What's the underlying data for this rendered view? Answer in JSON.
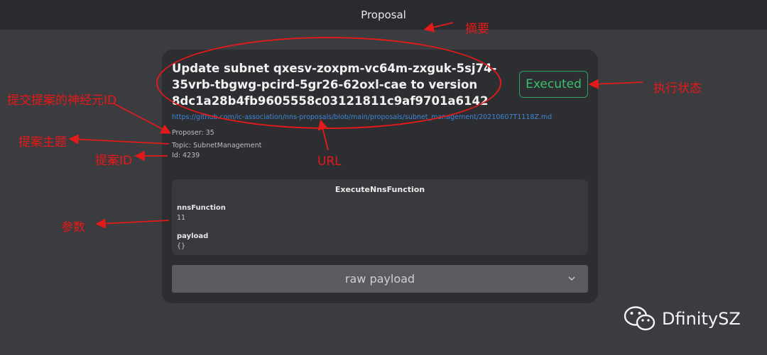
{
  "header": {
    "title": "Proposal"
  },
  "proposal": {
    "title": "Update subnet qxesv-zoxpm-vc64m-zxguk-5sj74-35vrb-tbgwg-pcird-5gr26-62oxl-cae to version 8dc1a28b4fb9605558c03121811c9af9701a6142",
    "status": "Executed",
    "url": "https://github.com/ic-association/nns-proposals/blob/main/proposals/subnet_management/20210607T1118Z.md",
    "proposer": "Proposer: 35",
    "topic": "Topic: SubnetManagement",
    "id": "Id: 4239",
    "payload": {
      "header": "ExecuteNnsFunction",
      "fields": [
        {
          "label": "nnsFunction",
          "value": "11"
        },
        {
          "label": "payload",
          "value": "{}"
        }
      ]
    },
    "raw_payload_label": "raw payload"
  },
  "annotations": {
    "summary": "摘要",
    "status": "执行状态",
    "proposer": "提交提案的神经元ID",
    "topic": "提案主题",
    "id": "提案ID",
    "url": "URL",
    "params": "参数"
  },
  "watermark": {
    "text": "DfinitySZ",
    "icon": "wechat-icon"
  },
  "colors": {
    "background": "#3a3c40",
    "card": "#2d2e31",
    "status_green": "#3cc06d",
    "link_blue": "#3f86d6",
    "annotation_red": "#e81818"
  }
}
